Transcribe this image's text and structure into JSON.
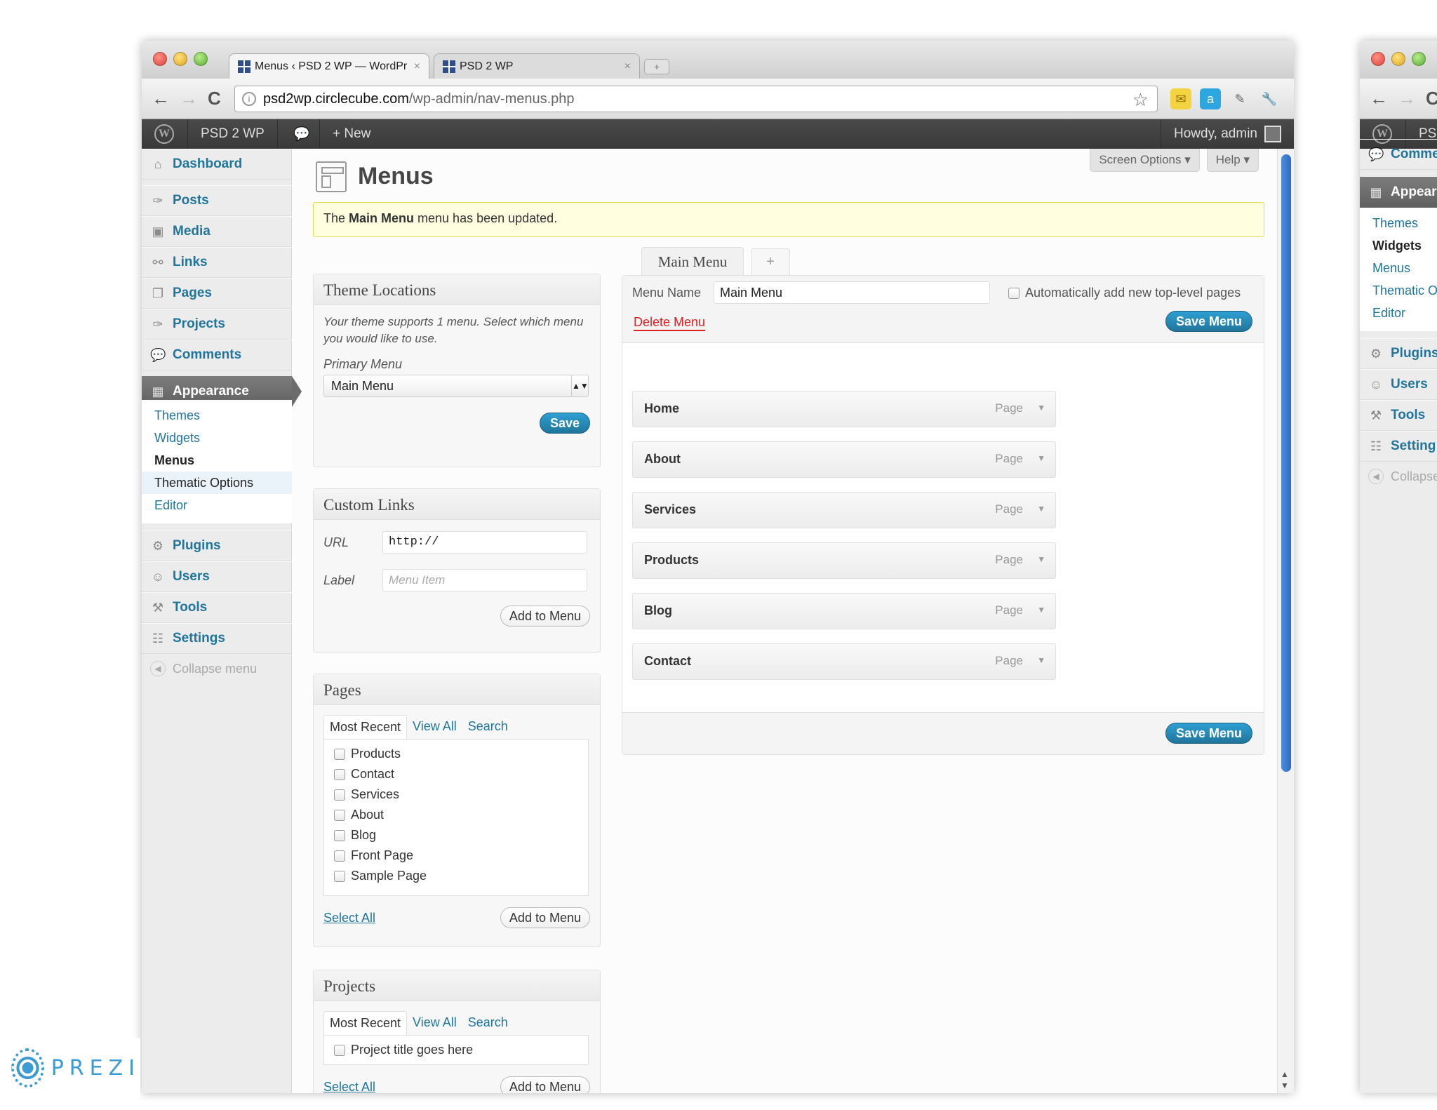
{
  "browser": {
    "tabs": [
      {
        "title": "Menus ‹ PSD 2 WP — WordPr",
        "close": "×"
      },
      {
        "title": "PSD 2 WP",
        "close": "×"
      }
    ],
    "newtab": "+",
    "url_host": "psd2wp.circlecube.com",
    "url_path": "/wp-admin/nav-menus.php",
    "nav": {
      "back": "←",
      "forward": "→",
      "reload": "C"
    },
    "star": "☆",
    "extensions": [
      {
        "icon": "mail-icon",
        "glyph": "✉",
        "color": "#e8c21c"
      },
      {
        "icon": "a-icon",
        "glyph": "a",
        "color": "#2ea7e0"
      },
      {
        "icon": "eyedropper-icon",
        "glyph": "✎",
        "color": "#666666"
      },
      {
        "icon": "wrench-icon",
        "glyph": "🔧",
        "color": "#555555"
      }
    ]
  },
  "adminbar": {
    "logo": "W",
    "site_name": "PSD 2 WP",
    "comments_glyph": "💬",
    "new_label": "+ New",
    "howdy": "Howdy, admin"
  },
  "sidebar": {
    "items": [
      {
        "label": "Dashboard",
        "icon": "home-icon",
        "glyph": "⌂"
      },
      {
        "label": "Posts",
        "icon": "pin-icon",
        "glyph": "✑"
      },
      {
        "label": "Media",
        "icon": "media-icon",
        "glyph": "▣"
      },
      {
        "label": "Links",
        "icon": "link-icon",
        "glyph": "⚯"
      },
      {
        "label": "Pages",
        "icon": "pages-icon",
        "glyph": "❐"
      },
      {
        "label": "Projects",
        "icon": "pin-icon",
        "glyph": "✑"
      },
      {
        "label": "Comments",
        "icon": "comment-icon",
        "glyph": "💬"
      },
      {
        "label": "Appearance",
        "icon": "appearance-icon",
        "glyph": "▦"
      },
      {
        "label": "Plugins",
        "icon": "plug-icon",
        "glyph": "⚙"
      },
      {
        "label": "Users",
        "icon": "users-icon",
        "glyph": "☺"
      },
      {
        "label": "Tools",
        "icon": "tools-icon",
        "glyph": "⚒"
      },
      {
        "label": "Settings",
        "icon": "settings-icon",
        "glyph": "☷"
      }
    ],
    "submenu": [
      "Themes",
      "Widgets",
      "Menus",
      "Thematic Options",
      "Editor"
    ],
    "collapse": "Collapse menu"
  },
  "screen": {
    "options": "Screen Options ▾",
    "help": "Help ▾"
  },
  "page_title": "Menus",
  "notice": {
    "pre": "The ",
    "bold": "Main Menu",
    "post": " menu has been updated."
  },
  "theme_locations": {
    "title": "Theme Locations",
    "description": "Your theme supports 1 menu. Select which menu you would like to use.",
    "primary_label": "Primary Menu",
    "selected": "Main Menu",
    "save": "Save"
  },
  "custom_links": {
    "title": "Custom Links",
    "url_label": "URL",
    "url_value": "http://",
    "label_label": "Label",
    "label_placeholder": "Menu Item",
    "add": "Add to Menu"
  },
  "pages_box": {
    "title": "Pages",
    "tabs": [
      "Most Recent",
      "View All",
      "Search"
    ],
    "items": [
      "Products",
      "Contact",
      "Services",
      "About",
      "Blog",
      "Front Page",
      "Sample Page"
    ],
    "select_all": "Select All",
    "add": "Add to Menu"
  },
  "projects_box": {
    "title": "Projects",
    "tabs": [
      "Most Recent",
      "View All",
      "Search"
    ],
    "items": [
      "Project title goes here"
    ],
    "select_all": "Select All",
    "add": "Add to Menu"
  },
  "menu_editor": {
    "tab_label": "Main Menu",
    "add_tab": "+",
    "name_label": "Menu Name",
    "name_value": "Main Menu",
    "auto_add": "Automatically add new top-level pages",
    "delete": "Delete Menu",
    "save": "Save Menu",
    "items": [
      {
        "title": "Home",
        "type": "Page"
      },
      {
        "title": "About",
        "type": "Page"
      },
      {
        "title": "Services",
        "type": "Page"
      },
      {
        "title": "Products",
        "type": "Page"
      },
      {
        "title": "Blog",
        "type": "Page"
      },
      {
        "title": "Contact",
        "type": "Page"
      }
    ]
  },
  "side_window": {
    "adminbar_text": "PS",
    "first_item": "Comme",
    "current": "Appeara",
    "submenu": [
      "Themes",
      "Widgets",
      "Menus",
      "Thematic O",
      "Editor"
    ],
    "items": [
      "Plugins",
      "Users",
      "Tools",
      "Setting"
    ],
    "collapse": "Collapse"
  },
  "watermark": "PREZI"
}
